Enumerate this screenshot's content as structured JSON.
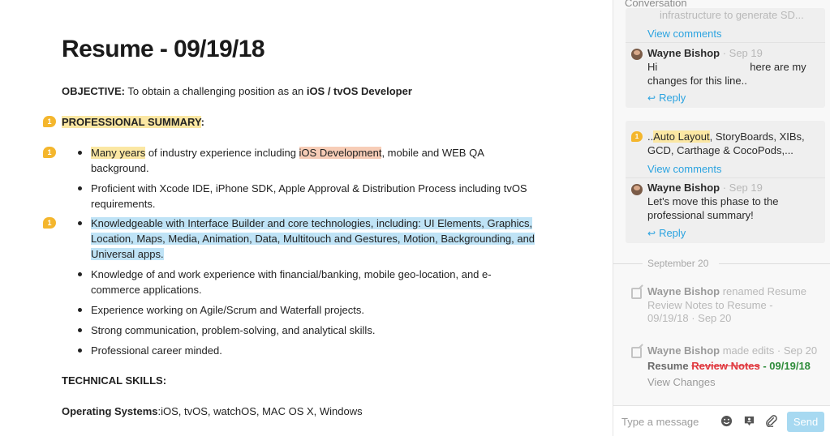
{
  "document": {
    "title": "Resume - 09/19/18",
    "objective_label": "OBJECTIVE:",
    "objective_text": " To obtain a challenging position as an ",
    "objective_role": "iOS / tvOS Developer",
    "summary_heading": "PROFESSIONAL SUMMARY",
    "summary_colon": ":",
    "comment_count": "1",
    "bullets": {
      "b1_hl1": "Many years",
      "b1_mid": " of industry experience including ",
      "b1_hl2": "iOS Development",
      "b1_end": ", mobile and WEB QA",
      "b1_l2": "background.",
      "b2_l1": "Proficient with Xcode IDE, iPhone SDK, Apple Approval & Distribution Process including tvOS",
      "b2_l2": "requirements.",
      "b3_l1": "Knowledgeable with Interface Builder and core technologies, including: UI Elements, Graphics,",
      "b3_l2": "Location, Maps, Media, Animation, Data, Multitouch and Gestures, Motion, Backgrounding, and",
      "b3_l3": "Universal apps.",
      "b4_l1": "Knowledge of and work experience with financial/banking, mobile geo-location, and e-",
      "b4_l2": "commerce applications.",
      "b5": "Experience working on Agile/Scrum and Waterfall projects.",
      "b6": "Strong communication, problem-solving, and analytical skills.",
      "b7": "Professional career minded."
    },
    "skills_heading": "TECHNICAL SKILLS:",
    "os_label": "Operating Systems",
    "os_value": ":iOS, tvOS, watchOS, MAC OS X, Windows"
  },
  "sidebar": {
    "title": "Conversation",
    "thread1": {
      "snippet": "infrastructure to generate SD...",
      "view_comments": "View comments",
      "author": "Wayne Bishop",
      "date": "· Sep 19",
      "text_l1_a": "Hi",
      "text_l1_b": "here are my",
      "text_l2": "changes for this line..",
      "reply": "Reply"
    },
    "thread2": {
      "badge": "1",
      "snippet_pre": "..",
      "snippet_hl": "Auto Layout",
      "snippet_l1_rest": ", StoryBoards, XIBs,",
      "snippet_l2": "GCD, Carthage & CocoPods,...",
      "view_comments": "View comments",
      "author": "Wayne Bishop",
      "date": "· Sep 19",
      "text_l1": "Let's move this phase to the",
      "text_l2": "professional summary!",
      "reply": "Reply"
    },
    "date_separator": "September 20",
    "event1": {
      "author": "Wayne Bishop",
      "action": " renamed Resume",
      "l2": "Review Notes to Resume -",
      "l3": "09/19/18 · Sep 20"
    },
    "event2": {
      "author": "Wayne Bishop",
      "action": " made edits · Sep 20",
      "prefix": "Resume ",
      "removed": "Review Notes",
      "added": " - 09/19/18",
      "view_changes": "View Changes"
    },
    "composer": {
      "placeholder": "Type a message",
      "send_label": "Send"
    }
  }
}
